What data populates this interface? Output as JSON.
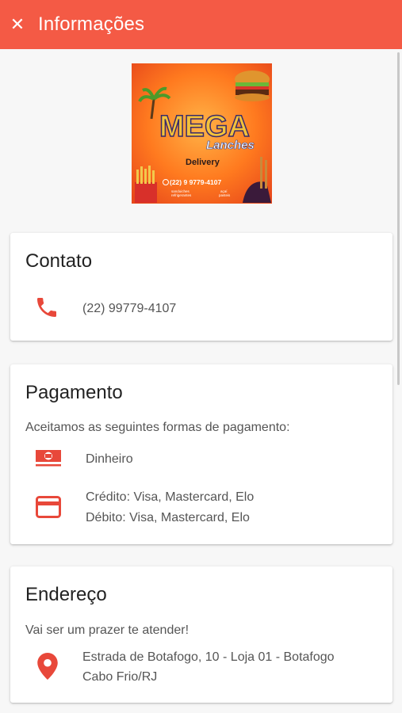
{
  "header": {
    "title": "Informações",
    "close_icon": "close-icon"
  },
  "logo": {
    "brand_main": "MEGA",
    "brand_sub": "Lanches",
    "tagline": "Delivery",
    "phone": "(22) 9 9779-4107",
    "items_left": "sanduiches\nrefrigerantes",
    "items_right": "açaí\npasteis"
  },
  "contact": {
    "title": "Contato",
    "phone_icon": "phone-icon",
    "phone": "(22) 99779-4107"
  },
  "payment": {
    "title": "Pagamento",
    "intro": "Aceitamos as seguintes formas de pagamento:",
    "cash_icon": "cash-icon",
    "cash": "Dinheiro",
    "card_icon": "credit-card-icon",
    "credit": "Crédito: Visa, Mastercard, Elo",
    "debit": "Débito: Visa, Mastercard, Elo"
  },
  "address": {
    "title": "Endereço",
    "intro": "Vai ser um prazer te atender!",
    "pin_icon": "location-pin-icon",
    "line1": "Estrada de Botafogo, 10 - Loja 01 - Botafogo",
    "line2": "Cabo Frio/RJ"
  },
  "colors": {
    "accent": "#f45a45",
    "icon": "#e8483a"
  }
}
